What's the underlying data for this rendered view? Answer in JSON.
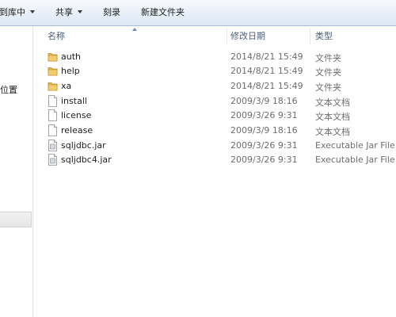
{
  "toolbar": {
    "include_in_library_label": "到库中",
    "share_label": "共享",
    "burn_label": "刻录",
    "new_folder_label": "新建文件夹"
  },
  "nav": {
    "partial_item_label": "位置"
  },
  "columns": {
    "name": "名称",
    "date_modified": "修改日期",
    "type": "类型"
  },
  "files": [
    {
      "name": "auth",
      "date": "2014/8/21 15:49",
      "type": "文件夹",
      "icon": "folder-icon"
    },
    {
      "name": "help",
      "date": "2014/8/21 15:49",
      "type": "文件夹",
      "icon": "folder-icon"
    },
    {
      "name": "xa",
      "date": "2014/8/21 15:49",
      "type": "文件夹",
      "icon": "folder-icon"
    },
    {
      "name": "install",
      "date": "2009/3/9 18:16",
      "type": "文本文档",
      "icon": "text-document-icon"
    },
    {
      "name": "license",
      "date": "2009/3/26 9:31",
      "type": "文本文档",
      "icon": "text-document-icon"
    },
    {
      "name": "release",
      "date": "2009/3/9 18:16",
      "type": "文本文档",
      "icon": "text-document-icon"
    },
    {
      "name": "sqljdbc.jar",
      "date": "2009/3/26 9:31",
      "type": "Executable Jar File",
      "icon": "jar-file-icon"
    },
    {
      "name": "sqljdbc4.jar",
      "date": "2009/3/26 9:31",
      "type": "Executable Jar File",
      "icon": "jar-file-icon"
    }
  ],
  "colors": {
    "toolbar_top": "#f6f9fd",
    "toolbar_bottom": "#dce7f4",
    "header_text": "#4c607a",
    "folder": "#e8b64a",
    "secondary_text": "#6d6d6d"
  }
}
